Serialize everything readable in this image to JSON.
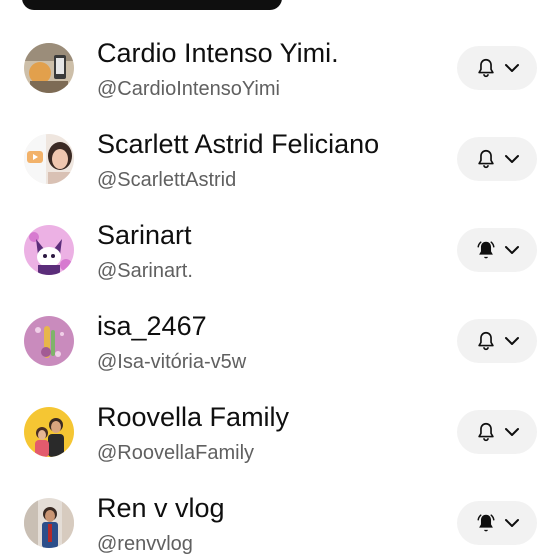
{
  "subscriptions": [
    {
      "name": "Cardio Intenso Yimi.",
      "handle": "@CardioIntensoYimi",
      "notification": "bell-outline",
      "avatar_color": "#c9b59a"
    },
    {
      "name": "Scarlett Astrid Feliciano",
      "handle": "@ScarlettAstrid",
      "notification": "bell-outline",
      "avatar_color": "#e8d6cc"
    },
    {
      "name": "Sarinart",
      "handle": "@Sarinart.",
      "notification": "bell-filled-ringing",
      "avatar_color": "#e9a7e0"
    },
    {
      "name": "isa_2467",
      "handle": "@Isa-vitória-v5w",
      "notification": "bell-outline",
      "avatar_color": "#c785b8"
    },
    {
      "name": "Roovella Family",
      "handle": "@RoovellaFamily",
      "notification": "bell-outline",
      "avatar_color": "#f4c531"
    },
    {
      "name": "Ren v vlog",
      "handle": "@renvvlog",
      "notification": "bell-filled-ringing",
      "avatar_color": "#d8d0c8"
    }
  ],
  "colors": {
    "text_primary": "#0f0f0f",
    "text_secondary": "#606060",
    "button_bg": "#f2f2f2"
  }
}
